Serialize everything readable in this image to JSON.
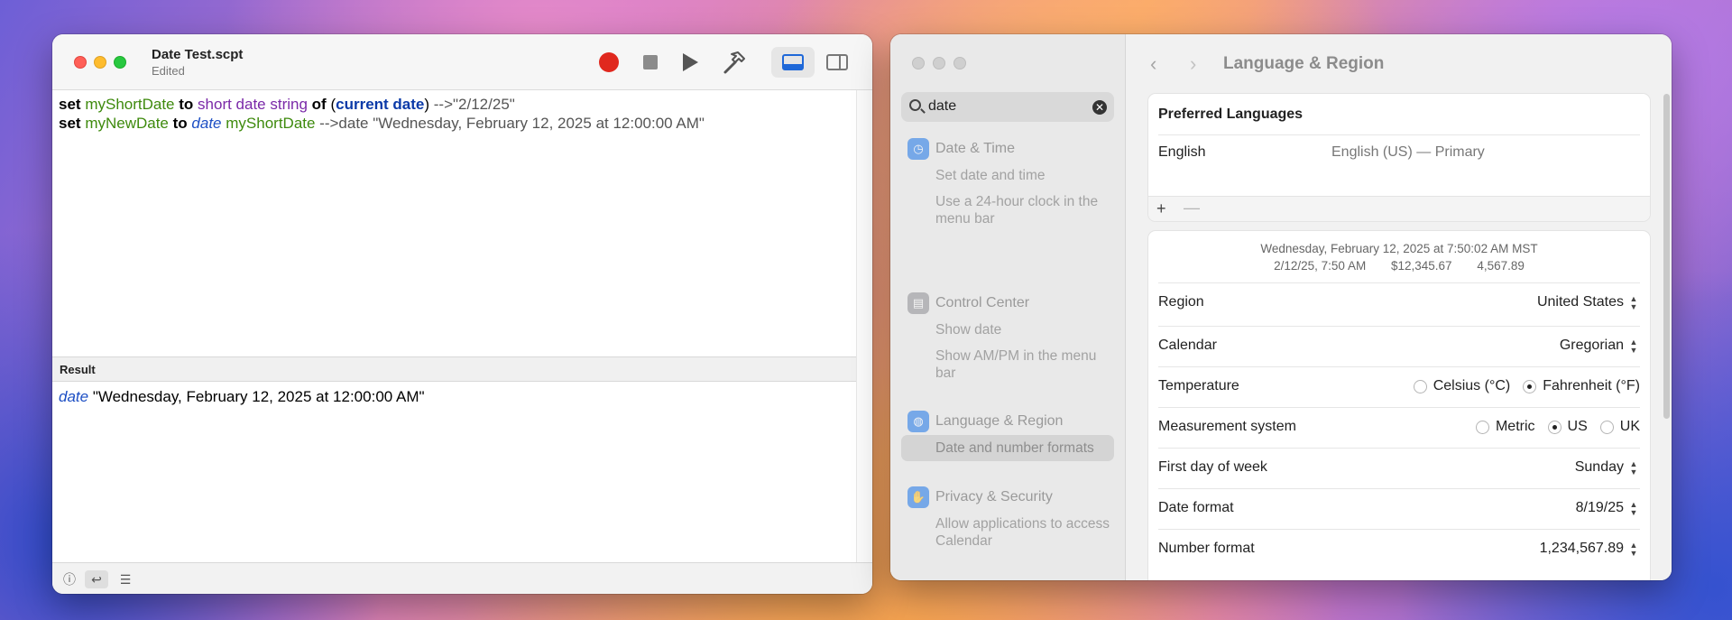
{
  "script_editor": {
    "title": "Date Test.scpt",
    "subtitle": "Edited",
    "code": {
      "line1": {
        "kw1": "set",
        "var": "myShortDate",
        "kw2": "to",
        "cmd": "short date string",
        "kw3": "of",
        "open": "(",
        "cls": "current date",
        "close": ")",
        "comment": " -->\"2/12/25\""
      },
      "line2": {
        "kw1": "set",
        "var": "myNewDate",
        "kw2": "to",
        "type": "date",
        "var2": "myShortDate",
        "comment": " -->date \"Wednesday, February 12, 2025 at 12:00:00 AM\""
      }
    },
    "result_header": "Result",
    "result": {
      "type": "date",
      "value": " \"Wednesday, February 12, 2025 at 12:00:00 AM\""
    },
    "colors": {
      "record": "#e0281e",
      "accent": "#1f68d8"
    }
  },
  "system_settings": {
    "search": {
      "value": "date"
    },
    "nav_title": "Language & Region",
    "sidebar": [
      {
        "label": "Date & Time",
        "icon": "clock-icon",
        "items": [
          "Set date and time",
          "Use a 24-hour clock in the menu bar"
        ]
      },
      {
        "label": "Control Center",
        "icon": "control-center-icon",
        "items": [
          "Show date",
          "Show AM/PM in the menu bar"
        ]
      },
      {
        "label": "Language & Region",
        "icon": "globe-icon",
        "items": [
          "Date and number formats"
        ]
      },
      {
        "label": "Privacy & Security",
        "icon": "hand-icon",
        "items": [
          "Allow applications to access Calendar"
        ]
      }
    ],
    "preferred_languages": {
      "title": "Preferred Languages",
      "language": "English",
      "description": "English (US) — Primary",
      "add": "+",
      "remove": "—"
    },
    "preview": {
      "line1": "Wednesday, February 12, 2025 at 7:50:02 AM MST",
      "date": "2/12/25, 7:50 AM",
      "currency": "$12,345.67",
      "number": "4,567.89"
    },
    "rows": {
      "region": {
        "label": "Region",
        "value": "United States"
      },
      "calendar": {
        "label": "Calendar",
        "value": "Gregorian"
      },
      "temperature": {
        "label": "Temperature",
        "options": [
          "Celsius (°C)",
          "Fahrenheit (°F)"
        ],
        "selected": "Fahrenheit (°F)"
      },
      "measurement": {
        "label": "Measurement system",
        "options": [
          "Metric",
          "US",
          "UK"
        ],
        "selected": "US"
      },
      "first_day": {
        "label": "First day of week",
        "value": "Sunday"
      },
      "date_format": {
        "label": "Date format",
        "value": "8/19/25"
      },
      "number_format": {
        "label": "Number format",
        "value": "1,234,567.89"
      }
    }
  }
}
